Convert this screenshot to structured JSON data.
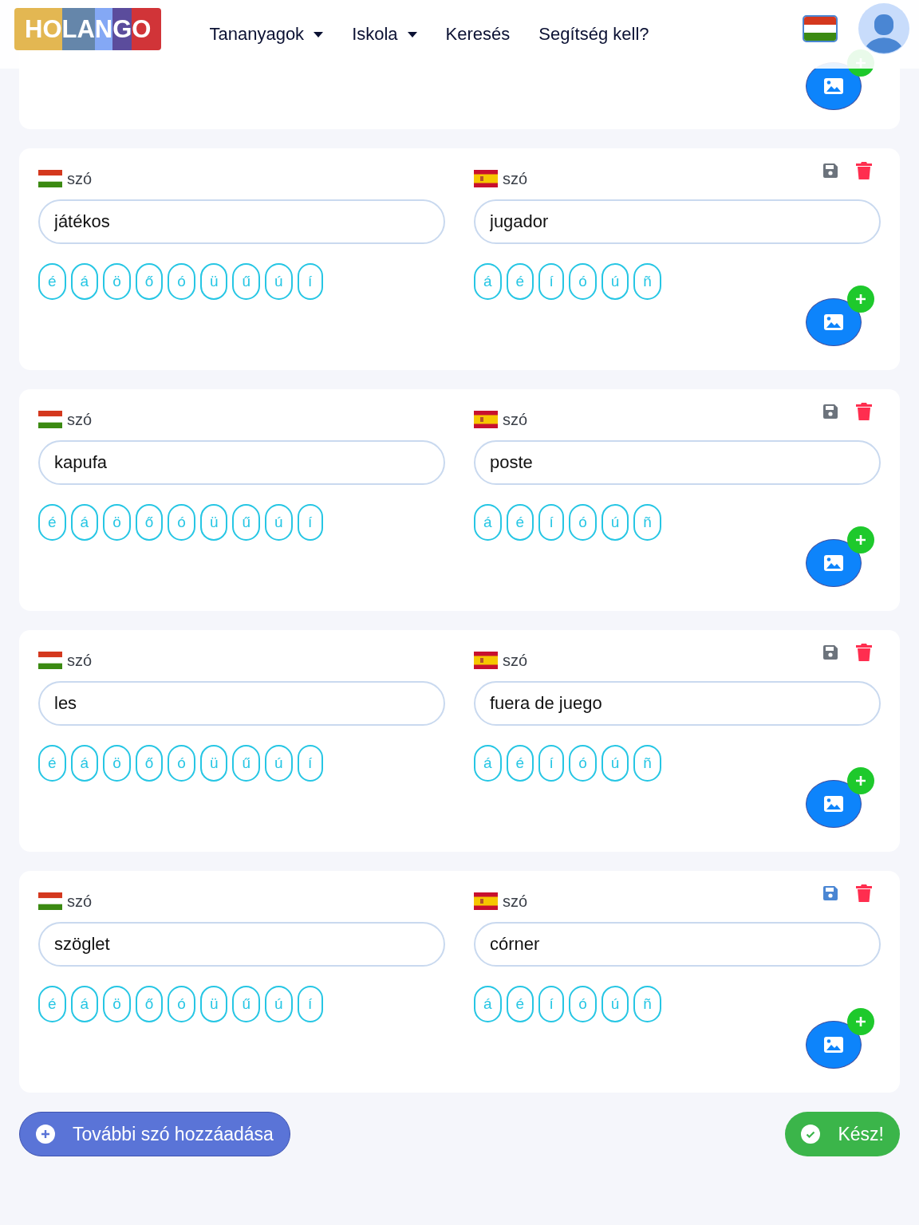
{
  "navbar": {
    "logo": [
      "HO",
      "L",
      "A",
      "N",
      "G",
      "O"
    ],
    "menu": [
      {
        "label": "Tananyagok",
        "dropdown": true
      },
      {
        "label": "Iskola",
        "dropdown": true
      },
      {
        "label": "Keresés",
        "dropdown": false
      },
      {
        "label": "Segítség kell?",
        "dropdown": false
      }
    ]
  },
  "cards": [
    {
      "partial": true
    },
    {
      "partial": false,
      "left": {
        "label": "szó",
        "value": "játékos",
        "accents": [
          "é",
          "á",
          "ö",
          "ő",
          "ó",
          "ü",
          "ű",
          "ú",
          "í"
        ]
      },
      "right": {
        "label": "szó",
        "value": "jugador",
        "accents": [
          "á",
          "é",
          "í",
          "ó",
          "ú",
          "ñ"
        ]
      },
      "save_enabled": false
    },
    {
      "partial": false,
      "left": {
        "label": "szó",
        "value": "kapufa",
        "accents": [
          "é",
          "á",
          "ö",
          "ő",
          "ó",
          "ü",
          "ű",
          "ú",
          "í"
        ]
      },
      "right": {
        "label": "szó",
        "value": "poste",
        "accents": [
          "á",
          "é",
          "í",
          "ó",
          "ú",
          "ñ"
        ]
      },
      "save_enabled": false
    },
    {
      "partial": false,
      "left": {
        "label": "szó",
        "value": "les",
        "accents": [
          "é",
          "á",
          "ö",
          "ő",
          "ó",
          "ü",
          "ű",
          "ú",
          "í"
        ]
      },
      "right": {
        "label": "szó",
        "value": "fuera de juego",
        "accents": [
          "á",
          "é",
          "í",
          "ó",
          "ú",
          "ñ"
        ]
      },
      "save_enabled": false
    },
    {
      "partial": false,
      "left": {
        "label": "szó",
        "value": "szöglet",
        "accents": [
          "é",
          "á",
          "ö",
          "ő",
          "ó",
          "ü",
          "ű",
          "ú",
          "í"
        ]
      },
      "right": {
        "label": "szó",
        "value": "córner",
        "accents": [
          "á",
          "é",
          "í",
          "ó",
          "ú",
          "ñ"
        ]
      },
      "save_enabled": true
    }
  ],
  "add_button": {
    "label": "További szó hozzáadása"
  },
  "done_button": {
    "label": "Kész!"
  }
}
